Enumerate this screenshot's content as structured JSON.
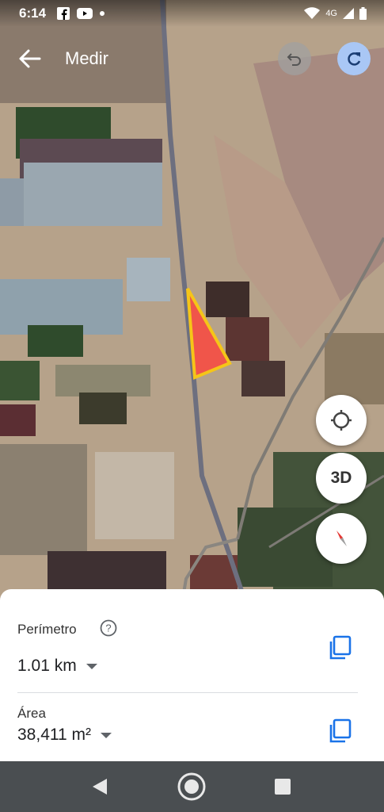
{
  "status_bar": {
    "time": "6:14",
    "network": "4G",
    "left_icons": [
      "facebook-icon",
      "youtube-icon",
      "dot-icon"
    ],
    "right_icons": [
      "wifi-icon",
      "signal-icon",
      "battery-icon"
    ]
  },
  "header": {
    "title": "Medir",
    "back_icon": "arrow-left-icon",
    "undo_icon": "undo-icon",
    "redo_icon": "redo-icon"
  },
  "map_controls": {
    "locate_icon": "crosshair-icon",
    "three_d_label": "3D",
    "compass_icon": "compass-icon"
  },
  "measurement": {
    "perimeter_label": "Perímetro",
    "perimeter_value": "1.01 km",
    "area_label": "Área",
    "area_value": "38,411 m²"
  },
  "colors": {
    "polygon_fill": "#f0554a",
    "polygon_stroke": "#f5c518",
    "accent_blue": "#1a73e8",
    "redo_bg": "#a9c7f5"
  },
  "nav_bar": {
    "icons": [
      "back-triangle-icon",
      "home-circle-icon",
      "recents-square-icon"
    ]
  }
}
